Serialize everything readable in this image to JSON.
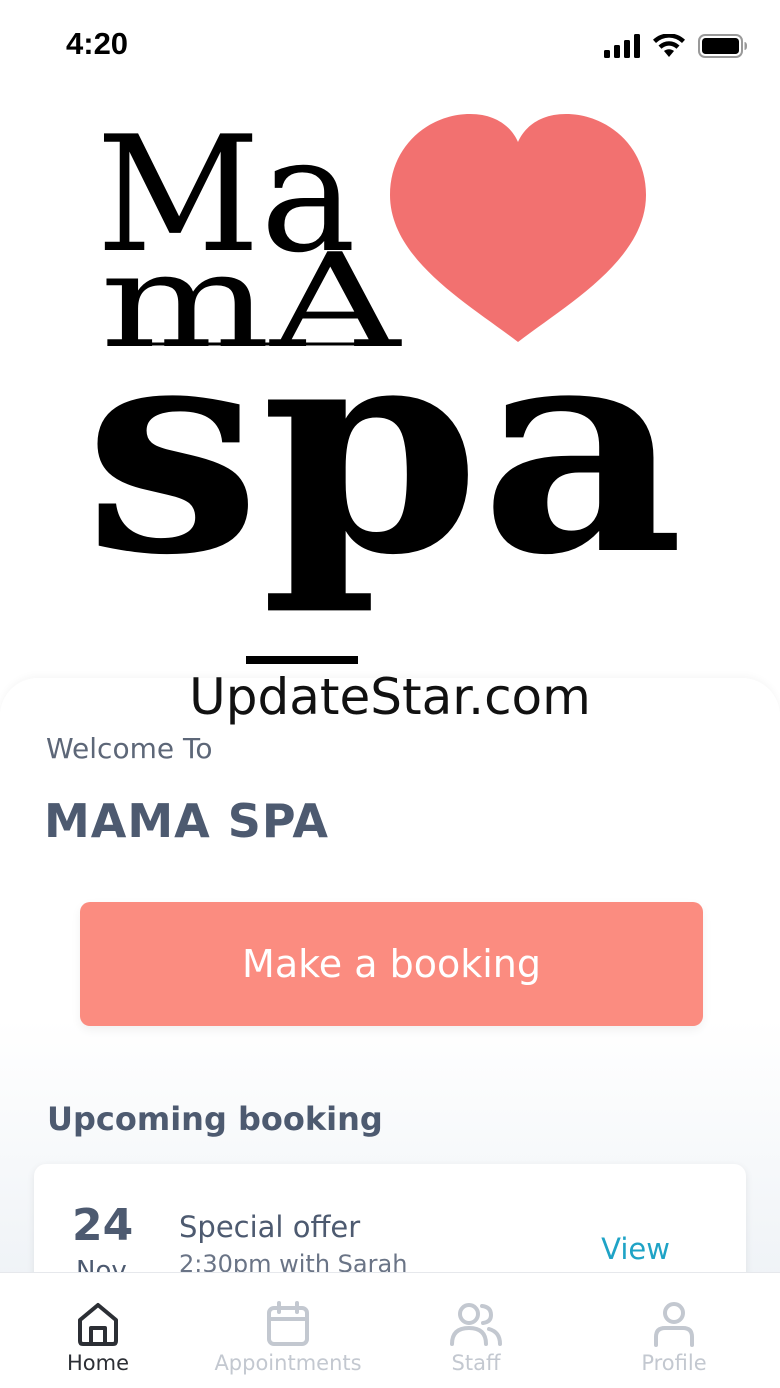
{
  "status_bar": {
    "time": "4:20"
  },
  "logo": {
    "line1": "Ma",
    "line2": "mA",
    "line3": "spa",
    "heart_color": "#f27170"
  },
  "watermark": "UpdateStar.com",
  "welcome_text": "Welcome To",
  "app_title": "MAMA SPA",
  "booking_button": {
    "label": "Make a booking",
    "color": "#fb8c80"
  },
  "upcoming": {
    "heading": "Upcoming booking",
    "booking": {
      "day": "24",
      "month": "Nov",
      "title": "Special offer",
      "detail": "2:30pm with Sarah",
      "action": "View"
    }
  },
  "tabs": [
    {
      "label": "Home",
      "icon": "home-icon",
      "active": true
    },
    {
      "label": "Appointments",
      "icon": "calendar-icon",
      "active": false
    },
    {
      "label": "Staff",
      "icon": "staff-icon",
      "active": false
    },
    {
      "label": "Profile",
      "icon": "profile-icon",
      "active": false
    }
  ],
  "colors": {
    "accent": "#fb8c80",
    "heading": "#4d5a70",
    "link": "#1fa3c6",
    "tab_inactive": "#c3c8d0"
  }
}
